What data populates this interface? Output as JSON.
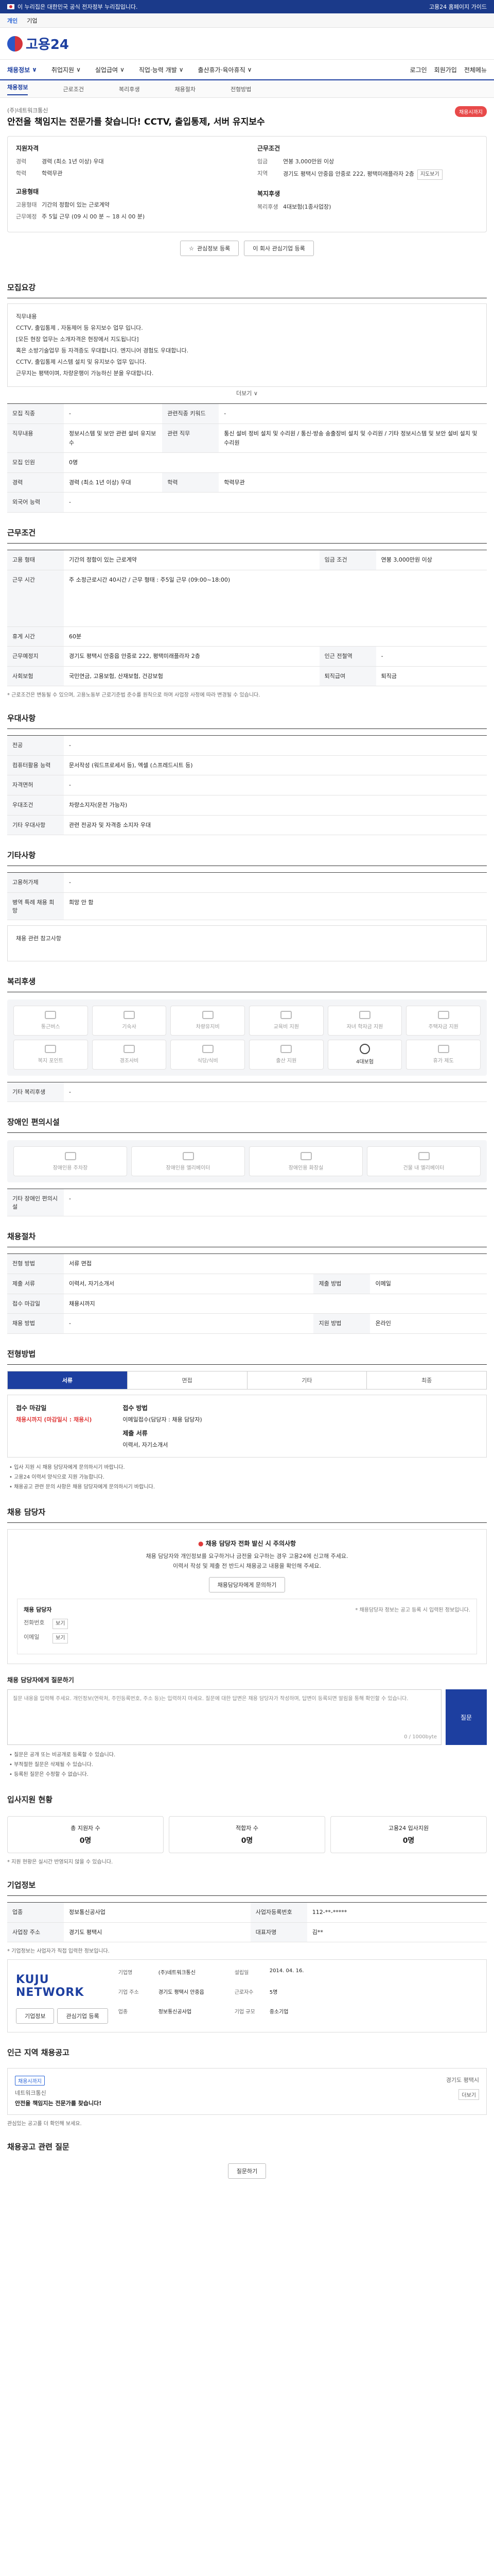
{
  "gov_bar": {
    "text": "이 누리집은 대한민국 공식 전자정부 누리집입니다.",
    "right": "고용24 홈페이지 가이드"
  },
  "lang_tabs": [
    "개인",
    "기업"
  ],
  "logo": {
    "text": "고용24"
  },
  "gnb": {
    "items": [
      "채용정보",
      "취업지원",
      "실업급여",
      "직업·능력 개발",
      "출산휴가·육아휴직"
    ],
    "right": [
      "로그인",
      "회원가입",
      "전체메뉴"
    ]
  },
  "subnav": [
    "채용정보",
    "근로조건",
    "복리후생",
    "채용절차",
    "전형방법"
  ],
  "job": {
    "company": "(주)네트워크통신",
    "title": "안전을 책임지는 전문가를 찾습니다! CCTV, 출입통제, 서버 유지보수",
    "badge": "채용시까지",
    "left_head": "지원자격",
    "left": [
      {
        "k": "경력",
        "v": "경력 (최소 1년 이상) 우대"
      },
      {
        "k": "학력",
        "v": "학력무관"
      }
    ],
    "left_head2": "고용형태",
    "left2": [
      {
        "k": "고용형태",
        "v": "기간의 정함이 있는 근로계약"
      },
      {
        "k": "근무예정",
        "v": "주 5일 근무 (09 시 00 분 ~ 18 시 00 분)"
      }
    ],
    "right_head": "근무조건",
    "right": [
      {
        "k": "임금",
        "v": "연봉 3,000만원 이상"
      },
      {
        "k": "지역",
        "v": "경기도 평택시 안중읍 안중로 222, 평택미래플라자 2층"
      }
    ],
    "right_head2": "복지후생",
    "right2": [
      {
        "k": "복리후생",
        "v": "4대보험(1종사업장)"
      }
    ],
    "map_link": "지도보기",
    "btn_scrap": "관심정보 등록",
    "btn_interest": "이 회사 관심기업 등록"
  },
  "sections": {
    "duty": "모집요강",
    "conditions": "근무조건",
    "qualification": "우대사항",
    "etc": "기타사항",
    "welfare": "복리후생",
    "disabled": "장애인 편의시설",
    "process": "채용절차",
    "method": "전형방법",
    "contact": "채용 담당자",
    "stats": "입사지원 현황",
    "company": "기업정보",
    "nearby": "인근 지역 채용공고"
  },
  "duty_text": [
    "직무내용",
    "CCTV, 출입통제 , 자동제어 등 유지보수 업무 입니다.",
    "[모든 현장 업무는 소개자격은 현장에서 지도됩니다]",
    "혹은 소방기술업무 등 자격증도 우대합니다. 엔지니어 경험도 우대합니다.",
    "CCTV, 출입통제 시스템 설치 및 유지보수 업무 입니다.",
    "근무지는 평택이며, 차량운행이 가능하신 분을 우대합니다."
  ],
  "more_label": "더보기 ∨",
  "recruit_rows": [
    {
      "k": "모집 직종",
      "v": "-",
      "k2": "관련직종 키워드",
      "v2": "-"
    },
    {
      "k": "직무내용",
      "v": "정보시스템 및 보안 관련 설비 유지보수",
      "k2": "관련 직무",
      "v2": "통신 설비 정비 설치 및 수리원 / 통신·방송 송출장비 설치 및 수리원 / 기타 정보시스템 및 보안 설비 설치 및 수리원"
    },
    {
      "k": "모집 인원",
      "v": "0명"
    },
    {
      "k": "경력",
      "v": "경력 (최소 1년 이상) 우대",
      "k2": "학력",
      "v2": "학력무관"
    },
    {
      "k": "외국어 능력",
      "v": "-"
    }
  ],
  "cond_rows": [
    {
      "k": "고용 형태",
      "v": "기간의 정함이 있는 근로계약",
      "k2": "임금 조건",
      "v2": "연봉 3,000만원 이상"
    },
    {
      "k": "근무 시간",
      "v": "주 소정근로시간 40시간 / 근무 형태 : 주5일 근무 (09:00~18:00)"
    },
    {
      "k": "휴게 시간",
      "v": "60분"
    },
    {
      "k": "근무예정지",
      "v": "경기도 평택시 안중읍 안중로 222, 평택미래플라자 2층",
      "k2": "인근 전철역",
      "v2": "-"
    },
    {
      "k": "사회보험",
      "v": "국민연금, 고용보험, 산재보험, 건강보험",
      "k2": "퇴직급여",
      "v2": "퇴직금"
    }
  ],
  "cond_note": "* 근로조건은 변동될 수 있으며, 고용노동부 근로기준법 준수를 원칙으로 하며 사업장 사정에 따라 변경될 수 있습니다.",
  "qual_rows": [
    {
      "k": "전공",
      "v": "-"
    },
    {
      "k": "컴퓨터활용 능력",
      "v": "문서작성 (워드프로세서 등), 엑셀 (스프레드시트 등)"
    },
    {
      "k": "자격면허",
      "v": "-"
    },
    {
      "k": "우대조건",
      "v": "차량소지자(운전 가능자)"
    },
    {
      "k": "기타 우대사항",
      "v": "관련 전공자 및 자격증 소지자 우대"
    }
  ],
  "etc_rows": [
    {
      "k": "고용허가제",
      "v": "-"
    },
    {
      "k": "병역 특례 채용 희망",
      "v": "희망 안 함"
    }
  ],
  "etc_note": "채용 관련 참고사항",
  "welfare_items": [
    "통근버스",
    "기숙사",
    "차량유지비",
    "교육비 지원",
    "자녀 학자금 지원",
    "주택자금 지원",
    "복지 포인트",
    "경조사비",
    "식당/식비",
    "출산 지원",
    "급여 제도",
    "휴가 제도"
  ],
  "welfare_active": "4대보험",
  "welfare_extra_label": "기타 복리후생",
  "disabled_items": [
    "장애인용 주차장",
    "장애인용 엘리베이터",
    "장애인용 화장실",
    "건물 내 엘리베이터"
  ],
  "disabled_extra_label": "기타 장애인 편의시설",
  "process_rows": [
    {
      "k": "전형 방법",
      "v": "서류 면접"
    },
    {
      "k": "제출 서류",
      "v": "이력서, 자기소개서",
      "k2": "제출 방법",
      "v2": "이메일"
    },
    {
      "k": "접수 마감일",
      "v": "채용시까지"
    },
    {
      "k": "채용 방법",
      "v": "-",
      "k2": "지원 방법",
      "v2": "온라인"
    }
  ],
  "method_tabs": [
    "서류",
    "면접",
    "기타",
    "최종"
  ],
  "apply": {
    "head1": "접수 마감일",
    "v1": "채용시까지 (마감일시 : 채용시)",
    "head2": "접수 방법",
    "v2": "이메일접수(담당자 : 채용 담당자)",
    "head3": "제출 서류",
    "v3": "이력서, 자기소개서"
  },
  "apply_notes": [
    "• 입사 지원 시 채용 담당자에게 문의하시기 바랍니다.",
    "• 고용24 이력서 양식으로 지원 가능합니다.",
    "• 채용공고 관련 문의 사항은 채용 담당자에게 문의하시기 바랍니다."
  ],
  "contact": {
    "warn": "채용 담당자 전화 발신 시 주의사항",
    "sub1": "채용 담당자와 개인정보를 요구하거나 금전을 요구하는 경우 고용24에 신고해 주세요.",
    "sub2": "이력서 작성 및 제출 전 반드시 채용공고 내용을 확인해 주세요.",
    "btn": "채용담당자에게 문의하기",
    "label": "채용 담당자",
    "right_note": "* 채용담당자 정보는 공고 등록 시 입력된 정보입니다.",
    "tel_label": "전화번호",
    "tel_btn": "보기",
    "email_label": "이메일",
    "email_btn": "보기"
  },
  "qna": {
    "label": "채용 담당자에게 질문하기",
    "placeholder": "질문 내용을 입력해 주세요. 개인정보(연락처, 주민등록번호, 주소 등)는 입력하지 마세요. 질문에 대한 답변은 채용 담당자가 작성하며, 답변이 등록되면 알림을 통해 확인할 수 있습니다.",
    "count": "0 / 1000byte",
    "btn": "질문",
    "notes": [
      "• 질문은 공개 또는 비공개로 등록할 수 있습니다.",
      "• 부적절한 질문은 삭제될 수 있습니다.",
      "• 등록된 질문은 수정할 수 없습니다."
    ]
  },
  "stats": [
    {
      "label": "총 지원자 수",
      "value": "0명"
    },
    {
      "label": "적합자 수",
      "value": "0명"
    },
    {
      "label": "고용24 입사지원",
      "value": "0명"
    }
  ],
  "stats_note": "* 지원 현황은 실시간 반영되지 않을 수 있습니다.",
  "company_rows": [
    {
      "k": "업종",
      "v": "정보통신공사업",
      "k2": "사업자등록번호",
      "v2": "112-**-*****"
    },
    {
      "k": "사업장 주소",
      "v": "경기도 평택시",
      "k2": "대표자명",
      "v2": "김**"
    }
  ],
  "company_note": "* 기업정보는 사업자가 직접 입력한 정보입니다.",
  "company_card": {
    "logo": "KUJU NETWORK",
    "items": [
      {
        "k": "기업명",
        "v": "(주)네트워크통신"
      },
      {
        "k": "설립일",
        "v": "2014. 04. 16."
      },
      {
        "k": "기업 주소",
        "v": "경기도 평택시 안중읍"
      },
      {
        "k": "근로자수",
        "v": "5명"
      },
      {
        "k": "업종",
        "v": "정보통신공사업"
      },
      {
        "k": "기업 규모",
        "v": "중소기업"
      }
    ],
    "btn1": "기업정보",
    "btn2": "관심기업 등록"
  },
  "nearby": {
    "badge": "채용시까지",
    "company": "네트워크통신",
    "title": "안전을 책임지는 전문가를 찾습니다!",
    "right": "경기도 평택시",
    "note": "관심있는 공고를 더 확인해 보세요.",
    "more": "더보기"
  },
  "chat": {
    "label": "채용공고 관련 질문"
  },
  "chat_btn": "질문하기"
}
